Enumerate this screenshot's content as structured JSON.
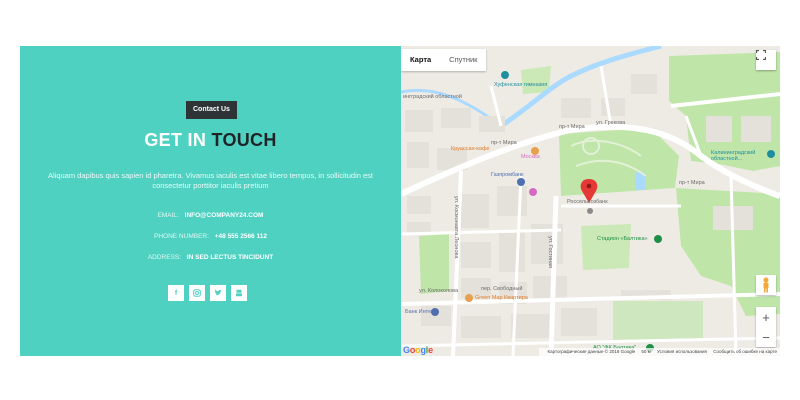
{
  "contact": {
    "badge": "Contact Us",
    "title_part1": "GET IN",
    "title_part2": "TOUCH",
    "description": "Aliquam dapibus quis sapien id pharetra. Vivamus iaculis est vitae libero tempus, in sollicitudin est consectetur porttitor iaculis pretium",
    "email_label": "EMAIL:",
    "email_value": "INFO@COMPANY24.COM",
    "phone_label": "PHONE NUMBER:",
    "phone_value": "+48 555 2566 112",
    "address_label": "ADDRESS:",
    "address_value": "IN SED LECTUS TINCIDUNT",
    "socials": [
      "facebook-icon",
      "instagram-icon",
      "twitter-icon",
      "youtube-icon"
    ],
    "colors": {
      "panel": "#4fd1c1",
      "badge": "#2e3336"
    }
  },
  "map": {
    "tab_map": "Карта",
    "tab_satellite": "Спутник",
    "labels": {
      "gymnasium": "Хуфенская гимназия",
      "kaliningrad_region": "Калининградский областной...",
      "krussancafe": "Круассан-кафе",
      "moskva": "Москва",
      "gazprombank": "Газпромбанк",
      "rosselkhozbank": "Россельхозбанк",
      "stadium": "Стадион «Балтика»",
      "greenmap": "Green Map Квартира",
      "bank_intesa": "Банк Интеза",
      "fk_baltika": "АО \"ФК Балтика\"",
      "pr_mira_1": "пр-т Мира",
      "pr_mira_2": "пр-т Мира",
      "pr_mira_3": "пр-т Мира",
      "ul_grekova": "ул. Грекова",
      "ul_gostinaya": "ул. Гостиная",
      "per_svobodny": "пер. Свободный",
      "ul_kosmonavta": "ул. Космонавта Леонова",
      "kaliningrad_left": "ингградский областной",
      "ul_kolokoltsova": "ул. Колоколова"
    },
    "attribution": "Картографические данные © 2018 Google",
    "scale": "50 м",
    "terms": "Условия использования",
    "report": "Сообщить об ошибке на карте",
    "google": "Google",
    "zoom_in": "+",
    "zoom_out": "−"
  }
}
